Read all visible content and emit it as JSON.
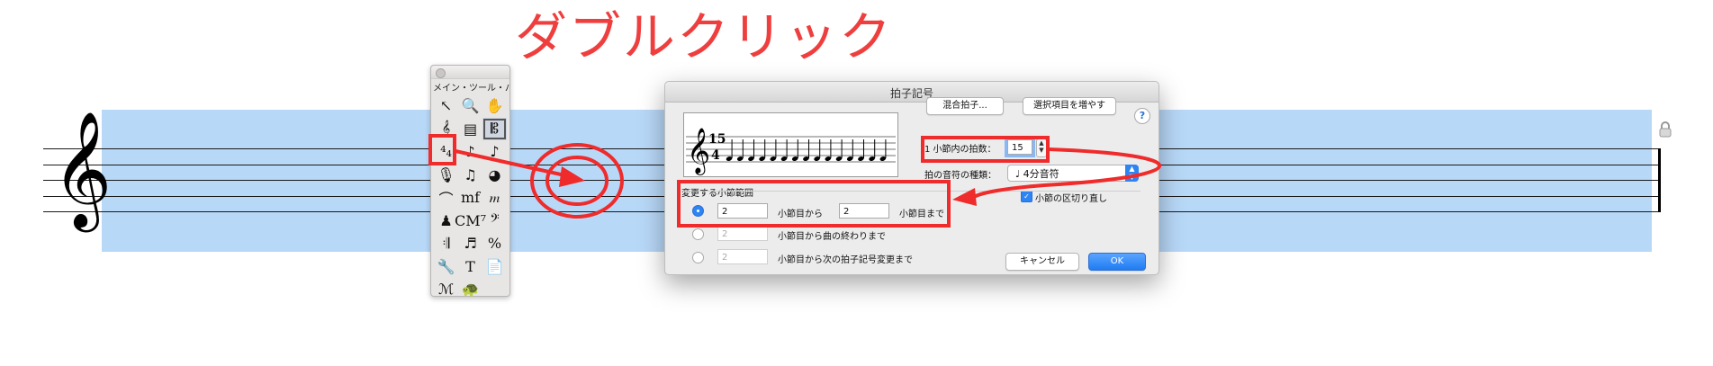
{
  "annotation": {
    "title": "ダブルクリック",
    "color": "#ef3e3e"
  },
  "score": {
    "selection_color": "#b8d8f8",
    "clef_glyph": "𝄞",
    "lock_icon": "lock-icon"
  },
  "palette": {
    "title": "メイン・ツール・パ",
    "tools": [
      {
        "name": "selection-tool-icon",
        "glyph": "↖"
      },
      {
        "name": "zoom-tool-icon",
        "glyph": "🔍"
      },
      {
        "name": "hand-grabber-tool-icon",
        "glyph": "✋"
      },
      {
        "name": "staff-tool-icon",
        "glyph": "𝄞"
      },
      {
        "name": "key-signature-tool-icon",
        "glyph": "▤"
      },
      {
        "name": "time-signature-tool-icon",
        "glyph": "𝄡"
      },
      {
        "name": "time-signature-tool-icon",
        "glyph": "⁴₄"
      },
      {
        "name": "simple-entry-tool-icon",
        "glyph": "♪"
      },
      {
        "name": "speedy-entry-tool-icon",
        "glyph": "♪"
      },
      {
        "name": "instrument-tool-icon",
        "glyph": "🎙"
      },
      {
        "name": "tuplet-tool-icon",
        "glyph": "♫"
      },
      {
        "name": "mixer-tool-icon",
        "glyph": "◕"
      },
      {
        "name": "smart-shape-tool-icon",
        "glyph": "⌒"
      },
      {
        "name": "expression-tool-icon",
        "glyph": "mf"
      },
      {
        "name": "articulation-tool-icon",
        "glyph": "𝆐"
      },
      {
        "name": "ossia-tool-icon",
        "glyph": "♟"
      },
      {
        "name": "chord-tool-icon",
        "glyph": "CM⁷"
      },
      {
        "name": "clef-tool-icon",
        "glyph": "𝄢"
      },
      {
        "name": "repeat-tool-icon",
        "glyph": "𝄇"
      },
      {
        "name": "mirror-tool-icon",
        "glyph": "♬"
      },
      {
        "name": "measure-tool-icon",
        "glyph": "%"
      },
      {
        "name": "special-tools-icon",
        "glyph": "🔧"
      },
      {
        "name": "text-tool-icon",
        "glyph": "T"
      },
      {
        "name": "page-layout-tool-icon",
        "glyph": "📄"
      },
      {
        "name": "lyrics-tool-icon",
        "glyph": "ℳ"
      },
      {
        "name": "graphics-tool-icon",
        "glyph": "🐢"
      }
    ]
  },
  "dialog": {
    "title": "拍子記号",
    "composite_button": "混合拍子...",
    "more_choices_button": "選択項目を増やす",
    "help_glyph": "?",
    "beats_label": "1 小節内の拍数：",
    "beats_value": "15",
    "beat_duration_label": "拍の音符の種類：",
    "beat_duration_value": "♩ 4分音符",
    "rebar_checkbox_label": "小節の区切り直し",
    "measure_region_label": "変更する小節範囲",
    "option1": {
      "from": "2",
      "from_label": "小節目から",
      "to": "2",
      "to_label": "小節目まで"
    },
    "option2": {
      "from": "2",
      "label": "小節目から曲の終わりまで"
    },
    "option3": {
      "from": "2",
      "label": "小節目から次の拍子記号変更まで"
    },
    "cancel_button": "キャンセル",
    "ok_button": "OK",
    "preview": {
      "numerator": "15",
      "denominator": "4",
      "note_count": 15
    }
  }
}
